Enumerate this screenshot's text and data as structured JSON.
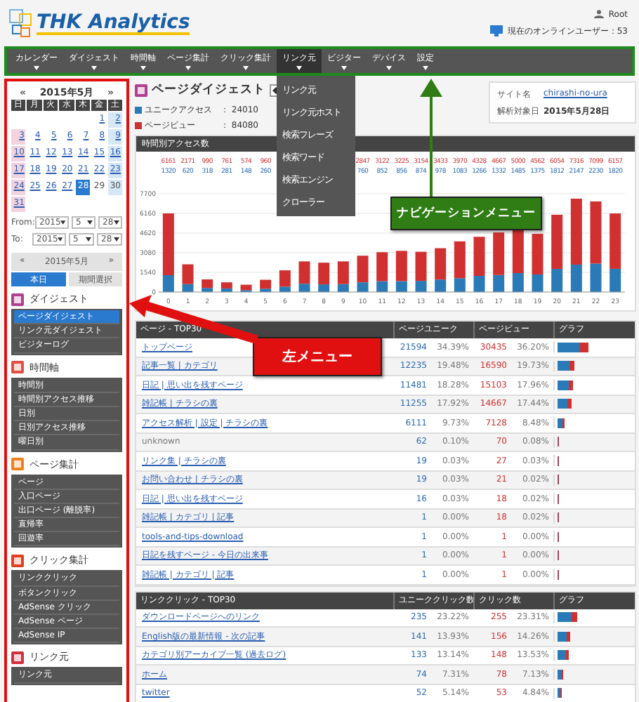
{
  "header": {
    "logo": "THK Analytics",
    "user": "Root",
    "online": "現在のオンラインユーザー：53"
  },
  "nav": [
    {
      "label": "カレンダー",
      "selected": false
    },
    {
      "label": "ダイジェスト",
      "selected": false
    },
    {
      "label": "時間軸",
      "selected": false
    },
    {
      "label": "ページ集計",
      "selected": false
    },
    {
      "label": "クリック集計",
      "selected": false
    },
    {
      "label": "リンク元",
      "selected": true,
      "menu": [
        "リンク元",
        "リンク元ホスト",
        "検索フレーズ",
        "検索ワード",
        "検索エンジン",
        "クローラー"
      ]
    },
    {
      "label": "ビジター",
      "selected": false
    },
    {
      "label": "デバイス",
      "selected": false
    },
    {
      "label": "設定",
      "selected": false
    }
  ],
  "calendar": {
    "prev": "«",
    "title": "2015年5月",
    "next": "»",
    "weekdays": [
      "日",
      "月",
      "火",
      "水",
      "木",
      "金",
      "土"
    ],
    "weeks": [
      {
        "kind": "first",
        "days": [
          {
            "label": "1",
            "selected": false,
            "disabled": false
          },
          {
            "label": "2",
            "selected": false,
            "disabled": false
          }
        ]
      },
      {
        "kind": "week",
        "days": [
          {
            "label": "3",
            "selected": false,
            "disabled": false
          },
          {
            "label": "4",
            "selected": false,
            "disabled": false
          },
          {
            "label": "5",
            "selected": false,
            "disabled": false
          },
          {
            "label": "6",
            "selected": false,
            "disabled": false
          },
          {
            "label": "7",
            "selected": false,
            "disabled": false
          },
          {
            "label": "8",
            "selected": false,
            "disabled": false
          },
          {
            "label": "9",
            "selected": false,
            "disabled": false
          }
        ]
      },
      {
        "kind": "week",
        "days": [
          {
            "label": "10",
            "selected": false,
            "disabled": false
          },
          {
            "label": "11",
            "selected": false,
            "disabled": false
          },
          {
            "label": "12",
            "selected": false,
            "disabled": false
          },
          {
            "label": "13",
            "selected": false,
            "disabled": false
          },
          {
            "label": "14",
            "selected": false,
            "disabled": false
          },
          {
            "label": "15",
            "selected": false,
            "disabled": false
          },
          {
            "label": "16",
            "selected": false,
            "disabled": false
          }
        ]
      },
      {
        "kind": "week",
        "days": [
          {
            "label": "17",
            "selected": false,
            "disabled": false
          },
          {
            "label": "18",
            "selected": false,
            "disabled": false
          },
          {
            "label": "19",
            "selected": false,
            "disabled": false
          },
          {
            "label": "20",
            "selected": false,
            "disabled": false
          },
          {
            "label": "21",
            "selected": false,
            "disabled": false
          },
          {
            "label": "22",
            "selected": false,
            "disabled": false
          },
          {
            "label": "23",
            "selected": false,
            "disabled": false
          }
        ]
      },
      {
        "kind": "week",
        "days": [
          {
            "label": "24",
            "selected": false,
            "disabled": false
          },
          {
            "label": "25",
            "selected": false,
            "disabled": false
          },
          {
            "label": "26",
            "selected": false,
            "disabled": false
          },
          {
            "label": "27",
            "selected": false,
            "disabled": false
          },
          {
            "label": "28",
            "selected": true,
            "disabled": false
          },
          {
            "label": "29",
            "selected": false,
            "disabled": true
          },
          {
            "label": "30",
            "selected": false,
            "disabled": true
          }
        ]
      },
      {
        "kind": "week",
        "days": [
          {
            "label": "31",
            "selected": false,
            "disabled": false
          }
        ]
      }
    ]
  },
  "range": [
    {
      "label": "From:",
      "year": "2015",
      "month": "5",
      "day": "28"
    },
    {
      "label": "To:",
      "year": "2015",
      "month": "5",
      "day": "28"
    }
  ],
  "month_nav": {
    "prev": "«",
    "title": "2015年5月",
    "next": "»"
  },
  "range_buttons": [
    {
      "label": "本日",
      "selected": true
    },
    {
      "label": "期間選択",
      "selected": false
    }
  ],
  "menu": [
    {
      "title": "ダイジェスト",
      "kind": "digest",
      "items": [
        {
          "label": "ページダイジェスト",
          "selected": true
        },
        {
          "label": "リンク元ダイジェスト",
          "selected": false
        },
        {
          "label": "ビジターログ",
          "selected": false
        }
      ]
    },
    {
      "title": "時間軸",
      "kind": "calendar",
      "items": [
        {
          "label": "時間別",
          "selected": false
        },
        {
          "label": "時間別アクセス推移",
          "selected": false
        },
        {
          "label": "日別",
          "selected": false
        },
        {
          "label": "日別アクセス推移",
          "selected": false
        },
        {
          "label": "曜日別",
          "selected": false
        }
      ]
    },
    {
      "title": "ページ集計",
      "kind": "page",
      "items": [
        {
          "label": "ページ",
          "selected": false
        },
        {
          "label": "入口ページ",
          "selected": false
        },
        {
          "label": "出口ページ (離脱率)",
          "selected": false
        },
        {
          "label": "直帰率",
          "selected": false
        },
        {
          "label": "回遊率",
          "selected": false
        }
      ]
    },
    {
      "title": "クリック集計",
      "kind": "click",
      "items": [
        {
          "label": "リンククリック",
          "selected": false
        },
        {
          "label": "ボタンクリック",
          "selected": false
        },
        {
          "label": "AdSense クリック",
          "selected": false
        },
        {
          "label": "AdSense ページ",
          "selected": false
        },
        {
          "label": "AdSense IP",
          "selected": false
        }
      ]
    },
    {
      "title": "リンク元",
      "kind": "referrer",
      "items": [
        {
          "label": "リンク元",
          "selected": false
        }
      ]
    }
  ],
  "page_title": "ページダイジェスト",
  "legend": [
    {
      "value": "： 24010"
    },
    {
      "value": "： 84080"
    }
  ],
  "site_info": [
    {
      "label": "サイト名",
      "value": "chirashi-no-ura",
      "link": true
    },
    {
      "label": "解析対象日",
      "value": "2015年5月28日",
      "link": false
    }
  ],
  "chart_panel": {
    "title": "時間別アクセス数",
    "labels_left": [
      {
        "views": "6161",
        "uniques": "1320"
      },
      {
        "views": "2171",
        "uniques": "620"
      },
      {
        "views": "990",
        "uniques": "318"
      },
      {
        "views": "761",
        "uniques": "281"
      },
      {
        "views": "574",
        "uniques": "148"
      },
      {
        "views": "960",
        "uniques": "260"
      }
    ],
    "labels_right": [
      {
        "views": "2847",
        "uniques": "760"
      },
      {
        "views": "3122",
        "uniques": "852"
      },
      {
        "views": "3225",
        "uniques": "856"
      },
      {
        "views": "3154",
        "uniques": "874"
      },
      {
        "views": "3433",
        "uniques": "978"
      },
      {
        "views": "3970",
        "uniques": "1083"
      },
      {
        "views": "4328",
        "uniques": "1266"
      },
      {
        "views": "4667",
        "uniques": "1332"
      },
      {
        "views": "5000",
        "uniques": "1485"
      },
      {
        "views": "4562",
        "uniques": "1375"
      },
      {
        "views": "6054",
        "uniques": "1812"
      },
      {
        "views": "7316",
        "uniques": "2147"
      },
      {
        "views": "7099",
        "uniques": "2230"
      },
      {
        "views": "6157",
        "uniques": "1820"
      }
    ],
    "chart_data": {
      "type": "bar",
      "categories": [
        "0",
        "1",
        "2",
        "3",
        "4",
        "5",
        "6",
        "7",
        "8",
        "9",
        "10",
        "11",
        "12",
        "13",
        "14",
        "15",
        "16",
        "17",
        "18",
        "19",
        "20",
        "21",
        "22",
        "23"
      ],
      "series": [
        {
          "name": "ユニークアクセス",
          "color": "#2a7ab8",
          "values": [
            1320,
            620,
            318,
            281,
            148,
            260,
            420,
            650,
            600,
            620,
            760,
            852,
            856,
            874,
            978,
            1083,
            1266,
            1332,
            1485,
            1375,
            1812,
            2147,
            2230,
            1820
          ]
        },
        {
          "name": "ページビュー",
          "color": "#d03030",
          "values": [
            4841,
            1551,
            672,
            480,
            426,
            700,
            1280,
            1750,
            1700,
            1780,
            2087,
            2270,
            2369,
            2280,
            2455,
            2887,
            3062,
            3335,
            3515,
            3187,
            4242,
            5169,
            4869,
            4337
          ]
        }
      ],
      "ylim": [
        0,
        7700
      ],
      "yticks": [
        0,
        1540,
        3080,
        4620,
        6160,
        7700
      ],
      "stacked": true,
      "grid": true
    }
  },
  "pages_table": {
    "columns": [
      "ページ - TOP30",
      "ページユニーク",
      "ページビュー",
      "グラフ"
    ],
    "rows": [
      {
        "title": "トップページ",
        "link": true,
        "unique": "21594",
        "unique_pct": "34.39%",
        "views": "30435",
        "views_pct": "36.20%",
        "level": 0.362
      },
      {
        "title": "記事一覧 | カテゴリ",
        "link": true,
        "unique": "12235",
        "unique_pct": "19.48%",
        "views": "16590",
        "views_pct": "19.73%",
        "level": 0.197
      },
      {
        "title": "日記 | 思い出を残すページ",
        "link": true,
        "unique": "11481",
        "unique_pct": "18.28%",
        "views": "15103",
        "views_pct": "17.96%",
        "level": 0.18
      },
      {
        "title": "雑記帳 | チラシの裏",
        "link": true,
        "unique": "11255",
        "unique_pct": "17.92%",
        "views": "14667",
        "views_pct": "17.44%",
        "level": 0.174
      },
      {
        "title": "アクセス解析 | 設定 | チラシの裏",
        "link": true,
        "unique": "6111",
        "unique_pct": "9.73%",
        "views": "7128",
        "views_pct": "8.48%",
        "level": 0.085
      },
      {
        "title": "unknown",
        "link": false,
        "unique": "62",
        "unique_pct": "0.10%",
        "views": "70",
        "views_pct": "0.08%",
        "level": 0.001
      },
      {
        "title": "リンク集 | チラシの裏",
        "link": true,
        "unique": "19",
        "unique_pct": "0.03%",
        "views": "27",
        "views_pct": "0.03%",
        "level": 0.0003
      },
      {
        "title": "お問い合わせ | チラシの裏",
        "link": true,
        "unique": "19",
        "unique_pct": "0.03%",
        "views": "21",
        "views_pct": "0.02%",
        "level": 0.0002
      },
      {
        "title": "日記 | 思い出を残すページ",
        "link": true,
        "unique": "16",
        "unique_pct": "0.03%",
        "views": "18",
        "views_pct": "0.02%",
        "level": 0.0002
      },
      {
        "title": "雑記帳 | カテゴリ | 記事",
        "link": true,
        "unique": "1",
        "unique_pct": "0.00%",
        "views": "18",
        "views_pct": "0.02%",
        "level": 0.0002
      },
      {
        "title": "tools-and-tips-download",
        "link": true,
        "unique": "1",
        "unique_pct": "0.00%",
        "views": "1",
        "views_pct": "0.00%",
        "level": 0
      },
      {
        "title": "日記を残すページ - 今日の出来事",
        "link": true,
        "unique": "1",
        "unique_pct": "0.00%",
        "views": "1",
        "views_pct": "0.00%",
        "level": 0
      },
      {
        "title": "雑記帳 | カテゴリ | 記事",
        "link": true,
        "unique": "1",
        "unique_pct": "0.00%",
        "views": "1",
        "views_pct": "0.00%",
        "level": 0
      }
    ]
  },
  "clicks_table": {
    "columns": [
      "リンククリック - TOP30",
      "ユニーククリック数",
      "クリック数",
      "グラフ"
    ],
    "rows": [
      {
        "title": "ダウンロードページへのリンク",
        "link": true,
        "unique": "235",
        "unique_pct": "23.22%",
        "views": "255",
        "views_pct": "23.31%",
        "level": 0.233
      },
      {
        "title": "English版の最新情報 - 次の記事",
        "link": true,
        "unique": "141",
        "unique_pct": "13.93%",
        "views": "156",
        "views_pct": "14.26%",
        "level": 0.143
      },
      {
        "title": "カテゴリ別アーカイブ一覧 (過去ログ)",
        "link": true,
        "unique": "133",
        "unique_pct": "13.14%",
        "views": "148",
        "views_pct": "13.53%",
        "level": 0.135
      },
      {
        "title": "ホーム",
        "link": true,
        "unique": "74",
        "unique_pct": "7.31%",
        "views": "78",
        "views_pct": "7.13%",
        "level": 0.071
      },
      {
        "title": "twitter",
        "link": true,
        "unique": "52",
        "unique_pct": "5.14%",
        "views": "53",
        "views_pct": "4.84%",
        "level": 0.048
      }
    ]
  },
  "callouts": [
    {
      "text": "ナビゲーションメニュー",
      "color": "#2f7d14"
    },
    {
      "text": "左メニュー",
      "color": "#e01010"
    }
  ]
}
